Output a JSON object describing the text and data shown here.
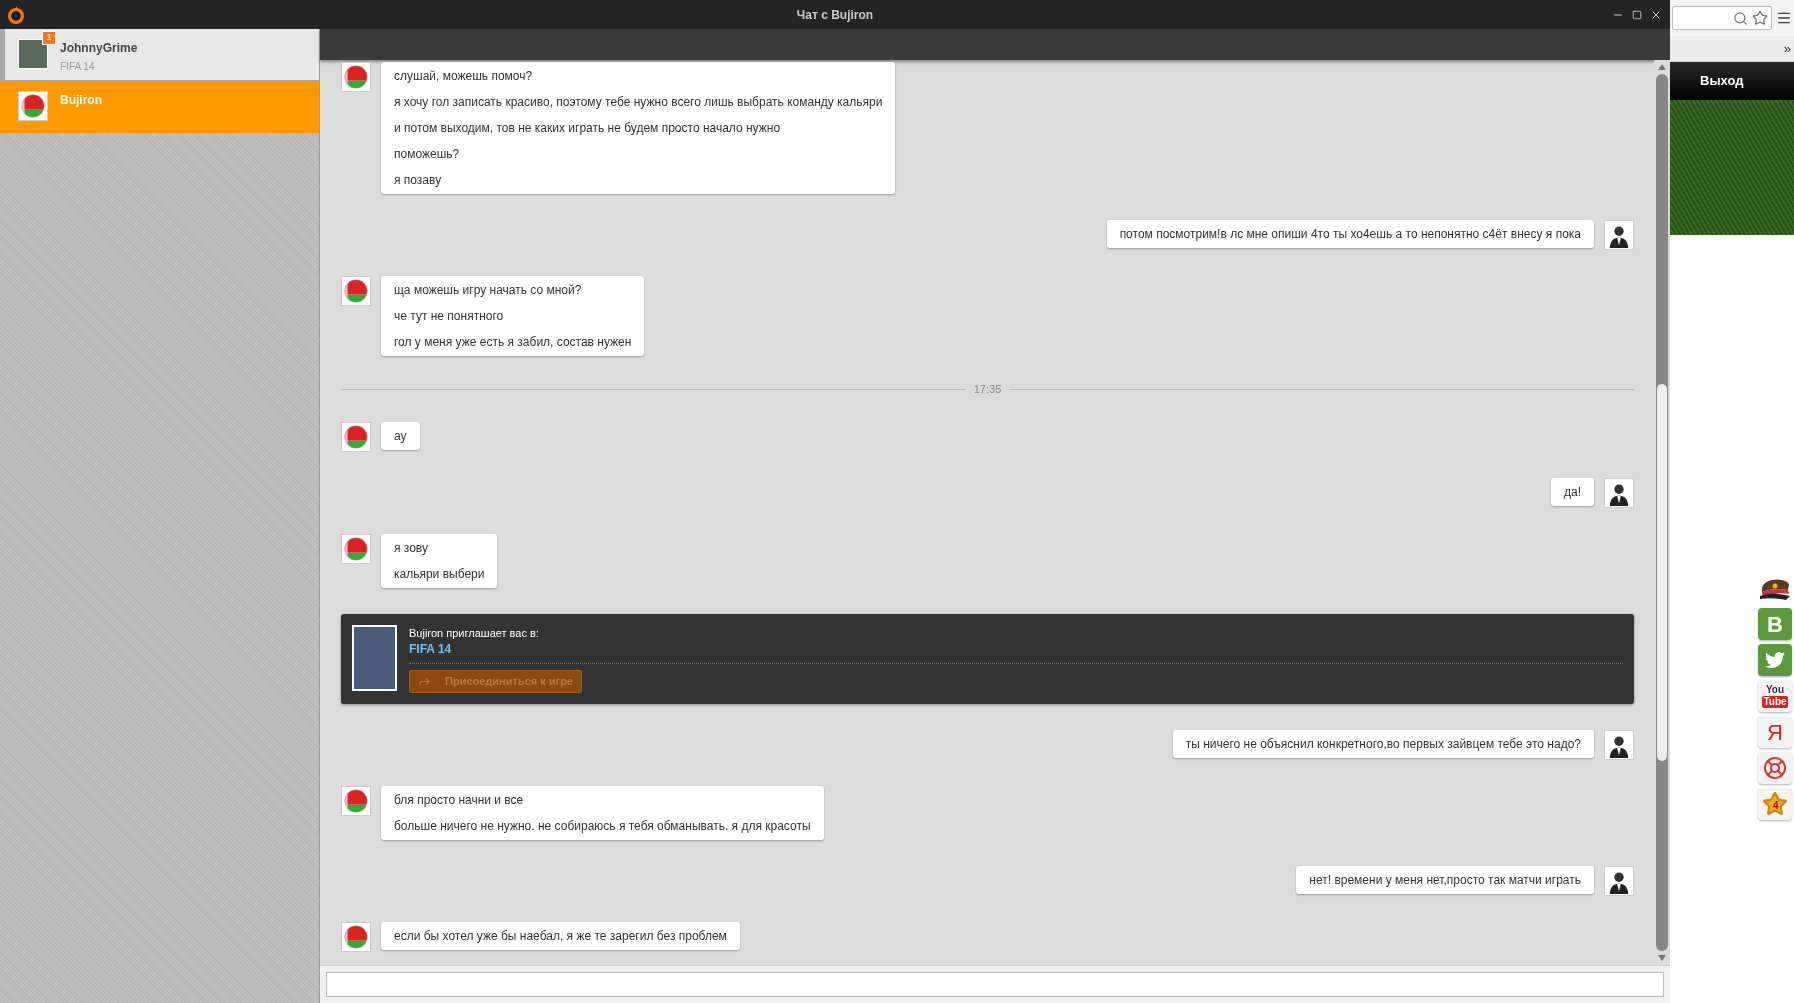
{
  "window": {
    "title": "Чат с Bujiron"
  },
  "contacts": [
    {
      "name": "JohnnyGrime",
      "status": "FIFA 14",
      "badge": "1",
      "kind": "photo",
      "unread": true,
      "selected": false
    },
    {
      "name": "Bujiron",
      "kind": "flag",
      "unread": false,
      "selected": true
    }
  ],
  "messages": [
    {
      "kind": "incoming",
      "lines": [
        "слушай, можешь помоч?",
        "я хочу гол записать красиво, поэтому тебе нужно всего лишь выбрать команду кальяри",
        "и потом выходим, тов не каких играть не будем просто начало нужно",
        "поможешь?",
        "я позаву"
      ]
    },
    {
      "kind": "outgoing",
      "lines": [
        "потом посмотрим!в лс мне опиши 4то ты хо4ешь а то непонятно с4ёт внесу я пока"
      ]
    },
    {
      "kind": "incoming",
      "lines": [
        "ща можешь игру начать со мной?",
        "че тут не понятного",
        "гол у меня уже есть я забил, состав нужен"
      ]
    },
    {
      "kind": "time",
      "text": "17:35"
    },
    {
      "kind": "incoming",
      "lines": [
        "ау"
      ]
    },
    {
      "kind": "outgoing",
      "lines": [
        "да!"
      ]
    },
    {
      "kind": "incoming",
      "lines": [
        "я зову",
        "кальяри выбери"
      ]
    },
    {
      "kind": "invite",
      "text": "Bujiron приглашает вас в:",
      "game": "FIFA 14",
      "button": "Присоединиться к игре"
    },
    {
      "kind": "outgoing",
      "lines": [
        "ты ничего не объяснил конкретного,во первых зайвцем тебе это надо?"
      ]
    },
    {
      "kind": "incoming",
      "lines": [
        "бля просто начни и все",
        "больше ничего не нужно. не собираюсь я тебя обманывать. я для красоты"
      ]
    },
    {
      "kind": "outgoing",
      "lines": [
        "нет! времени у меня нет,просто так матчи играть"
      ]
    },
    {
      "kind": "incoming",
      "lines": [
        "если бы хотел уже бы наебал, я же те зарегил без проблем"
      ]
    }
  ],
  "browser": {
    "overflow": "»",
    "nav_item": "Выход",
    "side_icons": [
      {
        "kind": "cap"
      },
      {
        "kind": "vk",
        "text": "В"
      },
      {
        "kind": "twitter"
      },
      {
        "kind": "youtube",
        "text": "You",
        "text2": "Tube"
      },
      {
        "kind": "yandex",
        "text": "Я"
      },
      {
        "kind": "lifebuoy"
      },
      {
        "kind": "star",
        "text": "4"
      }
    ]
  }
}
